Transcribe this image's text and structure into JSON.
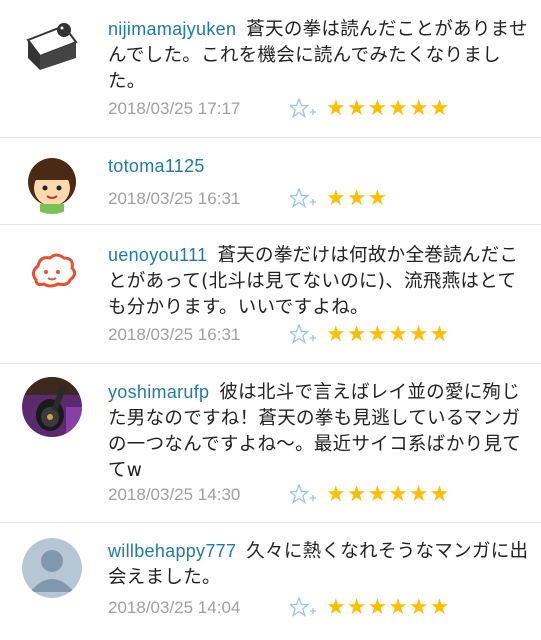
{
  "comments": [
    {
      "username": "nijimamajyuken",
      "text": "蒼天の拳は読んだことがありませんでした。これを機会に読んでみたくなりました。",
      "timestamp": "2018/03/25 17:17",
      "rating_text": "★★★★★★",
      "rating": 6,
      "avatar": "cake-icon"
    },
    {
      "username": "totoma1125",
      "text": "",
      "timestamp": "2018/03/25 16:31",
      "rating_text": "★★★",
      "rating": 3,
      "avatar": "girl-face-icon"
    },
    {
      "username": "uenoyou111",
      "text": "蒼天の拳だけは何故か全巻読んだことがあって(北斗は見てないのに)、流飛燕はとても分かります。いいですよね。",
      "timestamp": "2018/03/25 16:31",
      "rating_text": "★★★★★★",
      "rating": 6,
      "avatar": "cloud-face-icon"
    },
    {
      "username": "yoshimarufp",
      "text": "彼は北斗で言えばレイ並の愛に殉じた男なのですね！蒼天の拳も見逃しているマンガの一つなんですよね〜。最近サイコ系ばかり見ててw",
      "timestamp": "2018/03/25 14:30",
      "rating_text": "★★★★★★",
      "rating": 6,
      "avatar": "guitar-photo-icon"
    },
    {
      "username": "willbehappy777",
      "text": "久々に熱くなれそうなマンガに出会えました。",
      "timestamp": "2018/03/25 14:04",
      "rating_text": "★★★★★★",
      "rating": 6,
      "avatar": "default-user-icon"
    }
  ],
  "colors": {
    "username": "#1f7aa8",
    "timestamp": "#a0a0a0",
    "star": "#ffbf00",
    "star_add": "#9cc3e6"
  }
}
